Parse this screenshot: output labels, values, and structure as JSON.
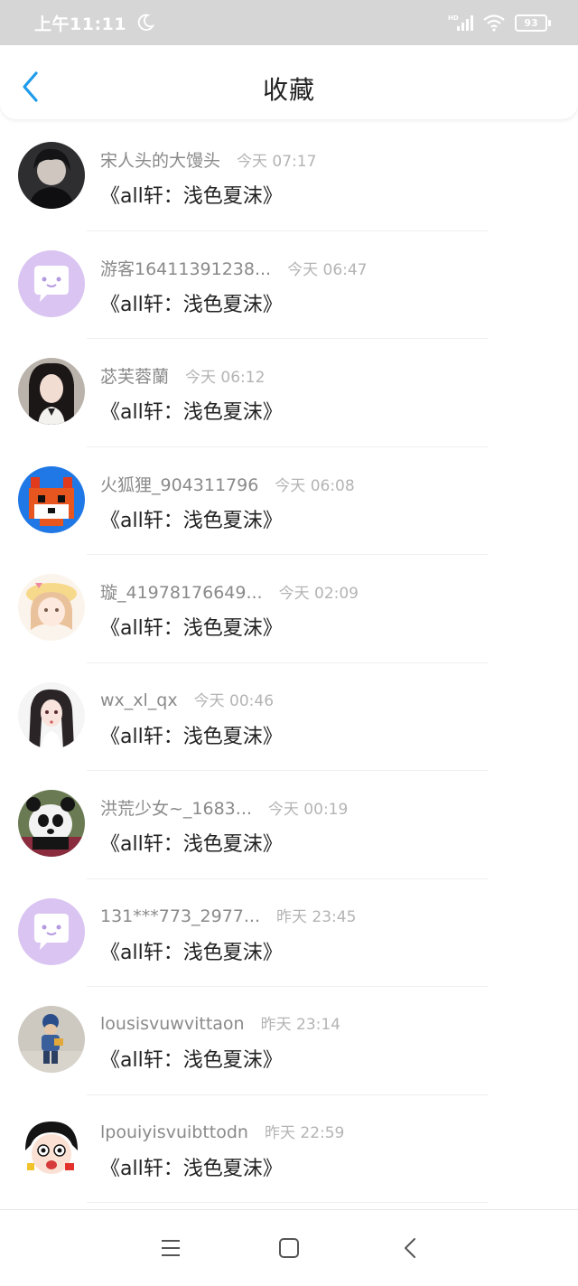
{
  "status_bar": {
    "time": "上午11:11",
    "network": "HD",
    "battery": "93"
  },
  "header": {
    "title": "收藏"
  },
  "favorites": [
    {
      "user": "宋人头的大馒头",
      "time": "今天 07:17",
      "title": "《all轩：浅色夏沫》",
      "avatar": "dark-hair-portrait"
    },
    {
      "user": "游客16411391238...",
      "time": "今天 06:47",
      "title": "《all轩：浅色夏沫》",
      "avatar": "default-chat-avatar"
    },
    {
      "user": "苾芙蓉蘭",
      "time": "今天 06:12",
      "title": "《all轩：浅色夏沫》",
      "avatar": "girl-portrait"
    },
    {
      "user": "火狐狸_904311796",
      "time": "今天 06:08",
      "title": "《all轩：浅色夏沫》",
      "avatar": "pixel-fox"
    },
    {
      "user": "璇_41978176649...",
      "time": "今天 02:09",
      "title": "《all轩：浅色夏沫》",
      "avatar": "anime-girl-hat"
    },
    {
      "user": "wx_xl_qx",
      "time": "今天 00:46",
      "title": "《all轩：浅色夏沫》",
      "avatar": "anime-girl-dark-hair"
    },
    {
      "user": "洪荒少女~_1683...",
      "time": "今天 00:19",
      "title": "《all轩：浅色夏沫》",
      "avatar": "panda"
    },
    {
      "user": "131***773_2977...",
      "time": "昨天 23:45",
      "title": "《all轩：浅色夏沫》",
      "avatar": "default-chat-avatar"
    },
    {
      "user": "lousisvuwvittaon",
      "time": "昨天 23:14",
      "title": "《all轩：浅色夏沫》",
      "avatar": "child-figure"
    },
    {
      "user": "lpouiyisvuibttodn",
      "time": "昨天 22:59",
      "title": "《all轩：浅色夏沫》",
      "avatar": "cartoon-face"
    }
  ],
  "colors": {
    "accent": "#1e9bea",
    "status_bar_bg": "#d6d6d6",
    "default_avatar_bg": "#d9c4f2",
    "username": "#8a8a8a",
    "timestamp": "#b4b4b4",
    "title_text": "#222222"
  }
}
